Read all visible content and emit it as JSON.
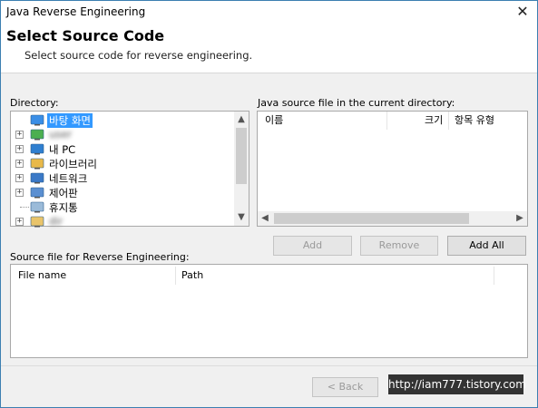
{
  "window": {
    "title": "Java Reverse Engineering",
    "close_glyph": "✕"
  },
  "header": {
    "title": "Select Source Code",
    "subtitle": "Select source code for reverse engineering."
  },
  "directory": {
    "label": "Directory:",
    "items": [
      {
        "label": "바탕 화면",
        "icon": "desktop-icon",
        "selected": true,
        "expander": ""
      },
      {
        "label": "user",
        "icon": "user-icon",
        "selected": false,
        "expander": "+",
        "blurred": true
      },
      {
        "label": "내 PC",
        "icon": "computer-icon",
        "selected": false,
        "expander": "+"
      },
      {
        "label": "라이브러리",
        "icon": "library-icon",
        "selected": false,
        "expander": "+"
      },
      {
        "label": "네트워크",
        "icon": "network-icon",
        "selected": false,
        "expander": "+"
      },
      {
        "label": "제어판",
        "icon": "control-panel-icon",
        "selected": false,
        "expander": "+"
      },
      {
        "label": "휴지통",
        "icon": "recycle-bin-icon",
        "selected": false,
        "expander": ""
      },
      {
        "label": "dir",
        "icon": "folder-icon",
        "selected": false,
        "expander": "+",
        "blurred": true
      }
    ]
  },
  "source_files": {
    "label": "Java source file in the current directory:",
    "columns": [
      "이름",
      "크기",
      "항목 유형"
    ]
  },
  "actions": {
    "add": "Add",
    "remove": "Remove",
    "add_all": "Add All"
  },
  "reverse_files": {
    "label": "Source file for Reverse Engineering:",
    "columns": [
      "File name",
      "Path"
    ]
  },
  "footer": {
    "back": "< Back"
  },
  "watermark": "http://iam777.tistory.com",
  "scroll": {
    "up": "▲",
    "down": "▼",
    "left": "◀",
    "right": "▶"
  }
}
